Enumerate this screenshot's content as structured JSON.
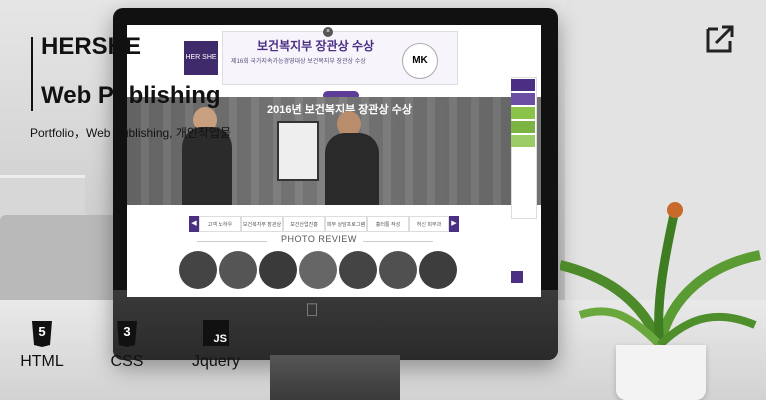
{
  "header": {
    "title_line1": "HERSHE",
    "title_line2": "Web Publishing",
    "subtitle": "Portfolio，Web Publishing, 개인작업물"
  },
  "site": {
    "logo": "HER SHE",
    "popup_title": "보건복지부 장관상 수상",
    "popup_sub": "제16회 국가지속가능경영대상 보건복지부 장관상 수상",
    "mk": "MK",
    "popup_close": "×",
    "hero_title": "2016년 보건복지부 장관상 수상",
    "tabs": [
      "고객 노하우",
      "보건복지부 장관상",
      "보건산업진흥",
      "피부 상담프로그램",
      "흉터통 작성",
      "허신 피부과"
    ],
    "photo_review": "PHOTO REVIEW",
    "prev_arrow": "◀",
    "next_arrow": "▶"
  },
  "tech": [
    {
      "icon_text": "5",
      "label": "HTML",
      "icon": "html5-icon"
    },
    {
      "icon_text": "3",
      "label": "CSS",
      "icon": "css3-icon"
    },
    {
      "icon_text": "JS",
      "label": "Jquery",
      "icon": "js-icon"
    }
  ],
  "colors": {
    "brand_purple": "#4a2f83",
    "accent_green": "#8bc34a"
  }
}
